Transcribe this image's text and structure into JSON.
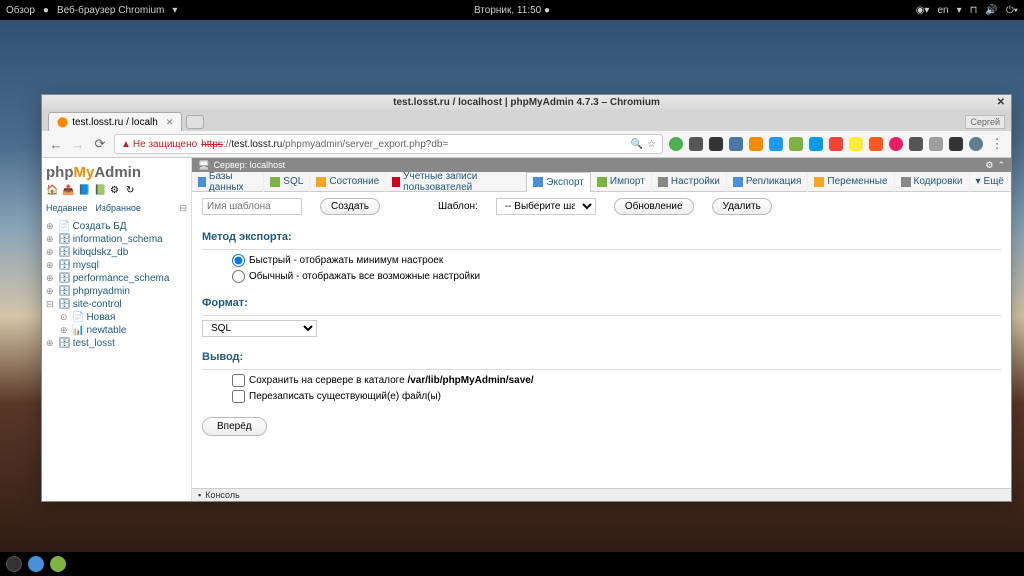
{
  "topbar": {
    "overview": "Обзор",
    "browser": "Веб-браузер Chromium",
    "clock": "Вторник, 11:50",
    "lang": "en"
  },
  "window": {
    "title": "test.losst.ru / localhost | phpMyAdmin 4.7.3 – Chromium"
  },
  "tab": {
    "title": "test.losst.ru / localh"
  },
  "user": "Сергей",
  "addr": {
    "notsecure": "Не защищено",
    "proto": "https",
    "sep": "://",
    "host": "test.losst.ru",
    "path": "/phpmyadmin/server_export.php?db="
  },
  "sidebar": {
    "recent": "Недавнее",
    "fav": "Избранное",
    "tree": [
      "Создать БД",
      "information_schema",
      "kibqdskz_db",
      "mysql",
      "performance_schema",
      "phpmyadmin",
      "site-control",
      "test_losst"
    ],
    "subtree": [
      "Новая",
      "newtable"
    ]
  },
  "server": {
    "label": "Сервер: localhost"
  },
  "tabs": [
    "Базы данных",
    "SQL",
    "Состояние",
    "Учетные записи пользователей",
    "Экспорт",
    "Импорт",
    "Настройки",
    "Репликация",
    "Переменные",
    "Кодировки",
    "Ещё"
  ],
  "template": {
    "placeholder": "Имя шаблона",
    "create": "Создать",
    "label": "Шаблон:",
    "select": "-- Выберите шаблон --",
    "update": "Обновление",
    "delete": "Удалить"
  },
  "export": {
    "method_h": "Метод экспорта:",
    "quick": "Быстрый - отображать минимум настроек",
    "custom": "Обычный - отображать все возможные настройки",
    "format_h": "Формат:",
    "format_val": "SQL",
    "output_h": "Вывод:",
    "save": "Сохранить на сервере в каталоге ",
    "savepath": "/var/lib/phpMyAdmin/save/",
    "overwrite": "Перезаписать существующий(е) файл(ы)",
    "go": "Вперёд"
  },
  "console": "Консоль"
}
